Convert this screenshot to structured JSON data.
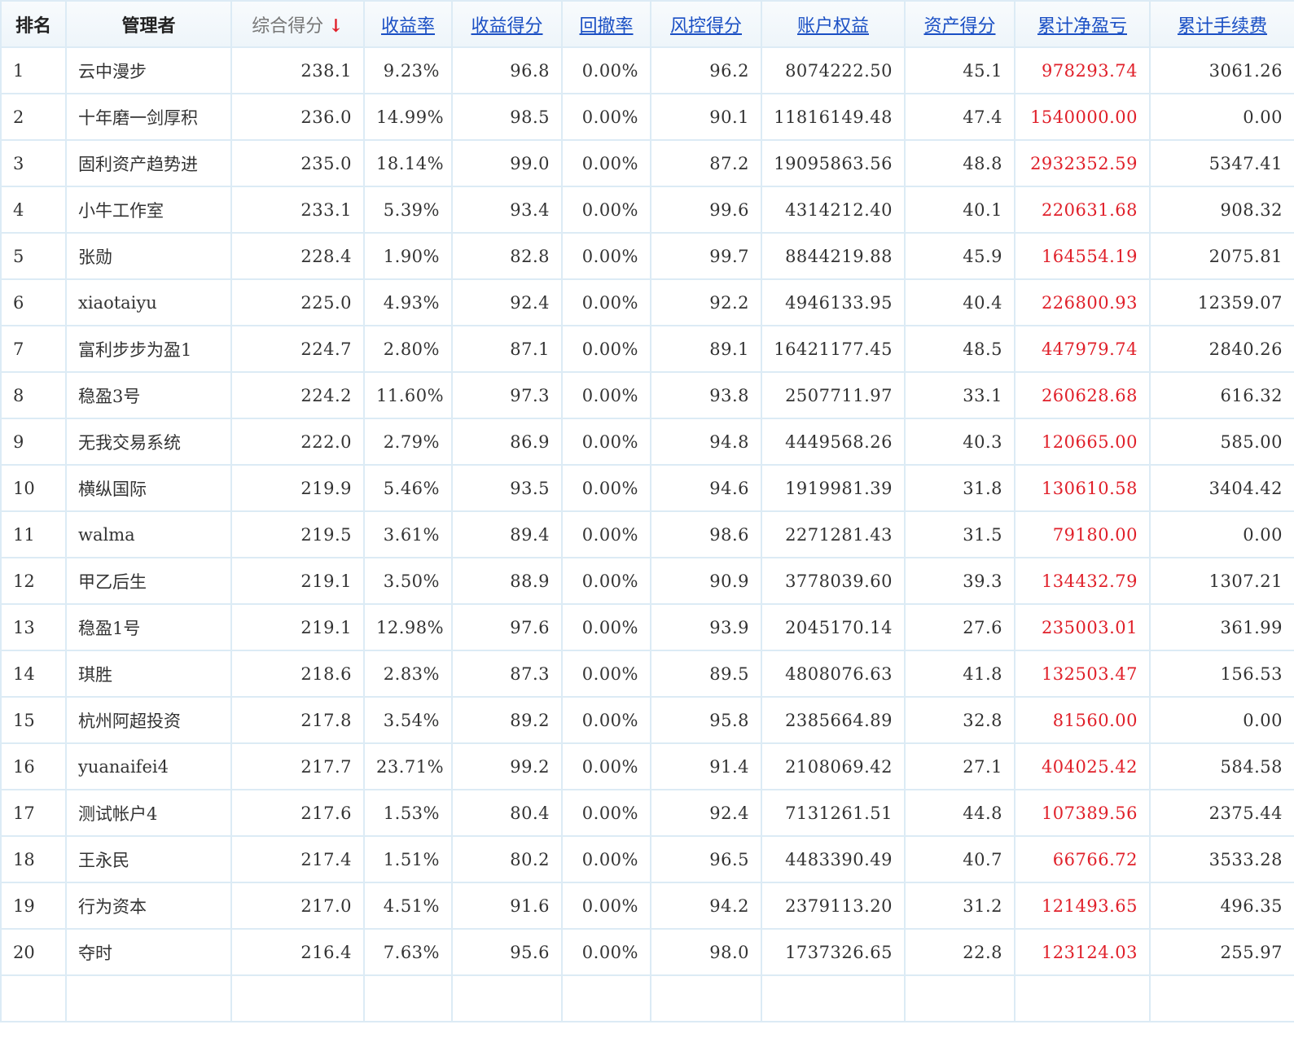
{
  "headers": {
    "rank": "排名",
    "manager": "管理者",
    "total_score": "综合得分",
    "sort_arrow": "↓",
    "return_rate": "收益率",
    "return_score": "收益得分",
    "drawdown": "回撤率",
    "risk_score": "风控得分",
    "equity": "账户权益",
    "asset_score": "资产得分",
    "net_pnl": "累计净盈亏",
    "fees": "累计手续费"
  },
  "colors": {
    "link": "#1a4fc4",
    "profit": "#e0202a",
    "border": "#dcebf5"
  },
  "rows": [
    {
      "rank": "1",
      "manager": "云中漫步",
      "total": "238.1",
      "rate": "9.23%",
      "rate_score": "96.8",
      "drawdown": "0.00%",
      "risk": "96.2",
      "equity": "8074222.50",
      "asset": "45.1",
      "pnl": "978293.74",
      "fees": "3061.26"
    },
    {
      "rank": "2",
      "manager": "十年磨一剑厚积",
      "total": "236.0",
      "rate": "14.99%",
      "rate_score": "98.5",
      "drawdown": "0.00%",
      "risk": "90.1",
      "equity": "11816149.48",
      "asset": "47.4",
      "pnl": "1540000.00",
      "fees": "0.00"
    },
    {
      "rank": "3",
      "manager": "固利资产趋势进",
      "total": "235.0",
      "rate": "18.14%",
      "rate_score": "99.0",
      "drawdown": "0.00%",
      "risk": "87.2",
      "equity": "19095863.56",
      "asset": "48.8",
      "pnl": "2932352.59",
      "fees": "5347.41"
    },
    {
      "rank": "4",
      "manager": "小牛工作室",
      "total": "233.1",
      "rate": "5.39%",
      "rate_score": "93.4",
      "drawdown": "0.00%",
      "risk": "99.6",
      "equity": "4314212.40",
      "asset": "40.1",
      "pnl": "220631.68",
      "fees": "908.32"
    },
    {
      "rank": "5",
      "manager": "张勋",
      "total": "228.4",
      "rate": "1.90%",
      "rate_score": "82.8",
      "drawdown": "0.00%",
      "risk": "99.7",
      "equity": "8844219.88",
      "asset": "45.9",
      "pnl": "164554.19",
      "fees": "2075.81"
    },
    {
      "rank": "6",
      "manager": "xiaotaiyu",
      "total": "225.0",
      "rate": "4.93%",
      "rate_score": "92.4",
      "drawdown": "0.00%",
      "risk": "92.2",
      "equity": "4946133.95",
      "asset": "40.4",
      "pnl": "226800.93",
      "fees": "12359.07"
    },
    {
      "rank": "7",
      "manager": "富利步步为盈1",
      "total": "224.7",
      "rate": "2.80%",
      "rate_score": "87.1",
      "drawdown": "0.00%",
      "risk": "89.1",
      "equity": "16421177.45",
      "asset": "48.5",
      "pnl": "447979.74",
      "fees": "2840.26"
    },
    {
      "rank": "8",
      "manager": "稳盈3号",
      "total": "224.2",
      "rate": "11.60%",
      "rate_score": "97.3",
      "drawdown": "0.00%",
      "risk": "93.8",
      "equity": "2507711.97",
      "asset": "33.1",
      "pnl": "260628.68",
      "fees": "616.32"
    },
    {
      "rank": "9",
      "manager": "无我交易系统",
      "total": "222.0",
      "rate": "2.79%",
      "rate_score": "86.9",
      "drawdown": "0.00%",
      "risk": "94.8",
      "equity": "4449568.26",
      "asset": "40.3",
      "pnl": "120665.00",
      "fees": "585.00"
    },
    {
      "rank": "10",
      "manager": "横纵国际",
      "total": "219.9",
      "rate": "5.46%",
      "rate_score": "93.5",
      "drawdown": "0.00%",
      "risk": "94.6",
      "equity": "1919981.39",
      "asset": "31.8",
      "pnl": "130610.58",
      "fees": "3404.42"
    },
    {
      "rank": "11",
      "manager": "walma",
      "total": "219.5",
      "rate": "3.61%",
      "rate_score": "89.4",
      "drawdown": "0.00%",
      "risk": "98.6",
      "equity": "2271281.43",
      "asset": "31.5",
      "pnl": "79180.00",
      "fees": "0.00"
    },
    {
      "rank": "12",
      "manager": "甲乙后生",
      "total": "219.1",
      "rate": "3.50%",
      "rate_score": "88.9",
      "drawdown": "0.00%",
      "risk": "90.9",
      "equity": "3778039.60",
      "asset": "39.3",
      "pnl": "134432.79",
      "fees": "1307.21"
    },
    {
      "rank": "13",
      "manager": "稳盈1号",
      "total": "219.1",
      "rate": "12.98%",
      "rate_score": "97.6",
      "drawdown": "0.00%",
      "risk": "93.9",
      "equity": "2045170.14",
      "asset": "27.6",
      "pnl": "235003.01",
      "fees": "361.99"
    },
    {
      "rank": "14",
      "manager": "琪胜",
      "total": "218.6",
      "rate": "2.83%",
      "rate_score": "87.3",
      "drawdown": "0.00%",
      "risk": "89.5",
      "equity": "4808076.63",
      "asset": "41.8",
      "pnl": "132503.47",
      "fees": "156.53"
    },
    {
      "rank": "15",
      "manager": "杭州阿超投资",
      "total": "217.8",
      "rate": "3.54%",
      "rate_score": "89.2",
      "drawdown": "0.00%",
      "risk": "95.8",
      "equity": "2385664.89",
      "asset": "32.8",
      "pnl": "81560.00",
      "fees": "0.00"
    },
    {
      "rank": "16",
      "manager": "yuanaifei4",
      "total": "217.7",
      "rate": "23.71%",
      "rate_score": "99.2",
      "drawdown": "0.00%",
      "risk": "91.4",
      "equity": "2108069.42",
      "asset": "27.1",
      "pnl": "404025.42",
      "fees": "584.58"
    },
    {
      "rank": "17",
      "manager": "测试帐户4",
      "total": "217.6",
      "rate": "1.53%",
      "rate_score": "80.4",
      "drawdown": "0.00%",
      "risk": "92.4",
      "equity": "7131261.51",
      "asset": "44.8",
      "pnl": "107389.56",
      "fees": "2375.44"
    },
    {
      "rank": "18",
      "manager": "王永民",
      "total": "217.4",
      "rate": "1.51%",
      "rate_score": "80.2",
      "drawdown": "0.00%",
      "risk": "96.5",
      "equity": "4483390.49",
      "asset": "40.7",
      "pnl": "66766.72",
      "fees": "3533.28"
    },
    {
      "rank": "19",
      "manager": "行为资本",
      "total": "217.0",
      "rate": "4.51%",
      "rate_score": "91.6",
      "drawdown": "0.00%",
      "risk": "94.2",
      "equity": "2379113.20",
      "asset": "31.2",
      "pnl": "121493.65",
      "fees": "496.35"
    },
    {
      "rank": "20",
      "manager": "夺时",
      "total": "216.4",
      "rate": "7.63%",
      "rate_score": "95.6",
      "drawdown": "0.00%",
      "risk": "98.0",
      "equity": "1737326.65",
      "asset": "22.8",
      "pnl": "123124.03",
      "fees": "255.97"
    }
  ]
}
